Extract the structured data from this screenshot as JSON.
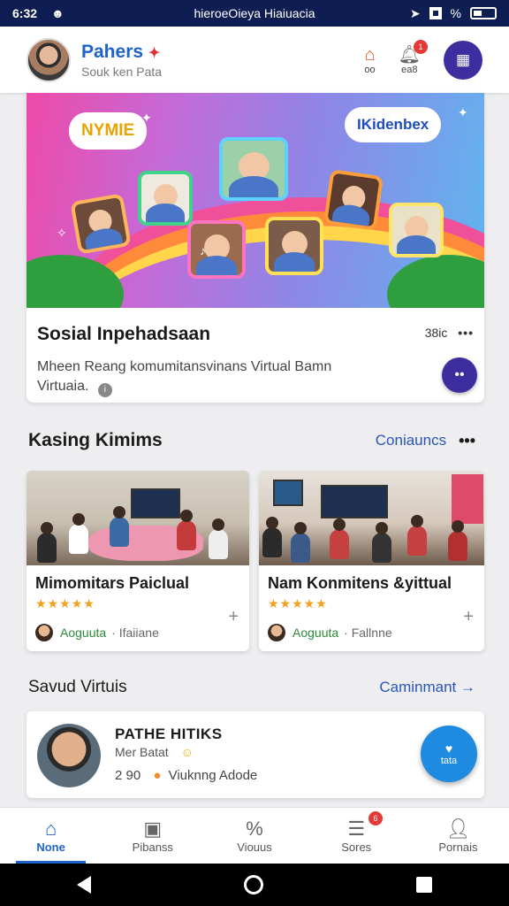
{
  "status_bar": {
    "time": "6:32",
    "title": "hieroeOieya Hiaiuacia",
    "battery_label": "%"
  },
  "header": {
    "user_name": "Pahers",
    "user_subtitle": "Souk ken Pata",
    "action1_label": "oo",
    "action2_label": "ea8",
    "notification_count": "1"
  },
  "hero": {
    "banner_left_text": "NYMIE",
    "banner_right_text": "IKidenbex",
    "title": "Sosial Inpehadsaan",
    "count": "38ic",
    "description": "Mheen Reang komumitansvinans  Virtual Bamn Virtuaia."
  },
  "section1": {
    "title": "Kasing Kimims",
    "link": "Coniauncs"
  },
  "communities": [
    {
      "title": "Mimomitars Paiclual",
      "stars": "★★★★★",
      "author": "Aoguuta",
      "meta": "· Ifaiiane"
    },
    {
      "title": "Nam Konmitens &yittual",
      "stars": "★★★★★",
      "author": "Aoguuta",
      "meta": "· Fallnne"
    }
  ],
  "section2": {
    "title": "Savud Virtuis",
    "link": "Caminmant →"
  },
  "person": {
    "name": "PATHE HITIKS",
    "subtitle": "Mer Batat",
    "stat_number": "2 90",
    "stat_text": "Viuknng Adode"
  },
  "fab_label": "tata",
  "nav": [
    {
      "label": "None",
      "icon": "home-icon"
    },
    {
      "label": "Pibanss",
      "icon": "board-icon"
    },
    {
      "label": "Viouus",
      "icon": "percent-icon"
    },
    {
      "label": "Sores",
      "icon": "list-icon",
      "badge": "6"
    },
    {
      "label": "Pornais",
      "icon": "person-icon"
    }
  ],
  "colors": {
    "accent": "#1e63c9",
    "header_bar": "#0f1e52",
    "round_button": "#3d2ea0",
    "fab": "#1e8be0"
  }
}
